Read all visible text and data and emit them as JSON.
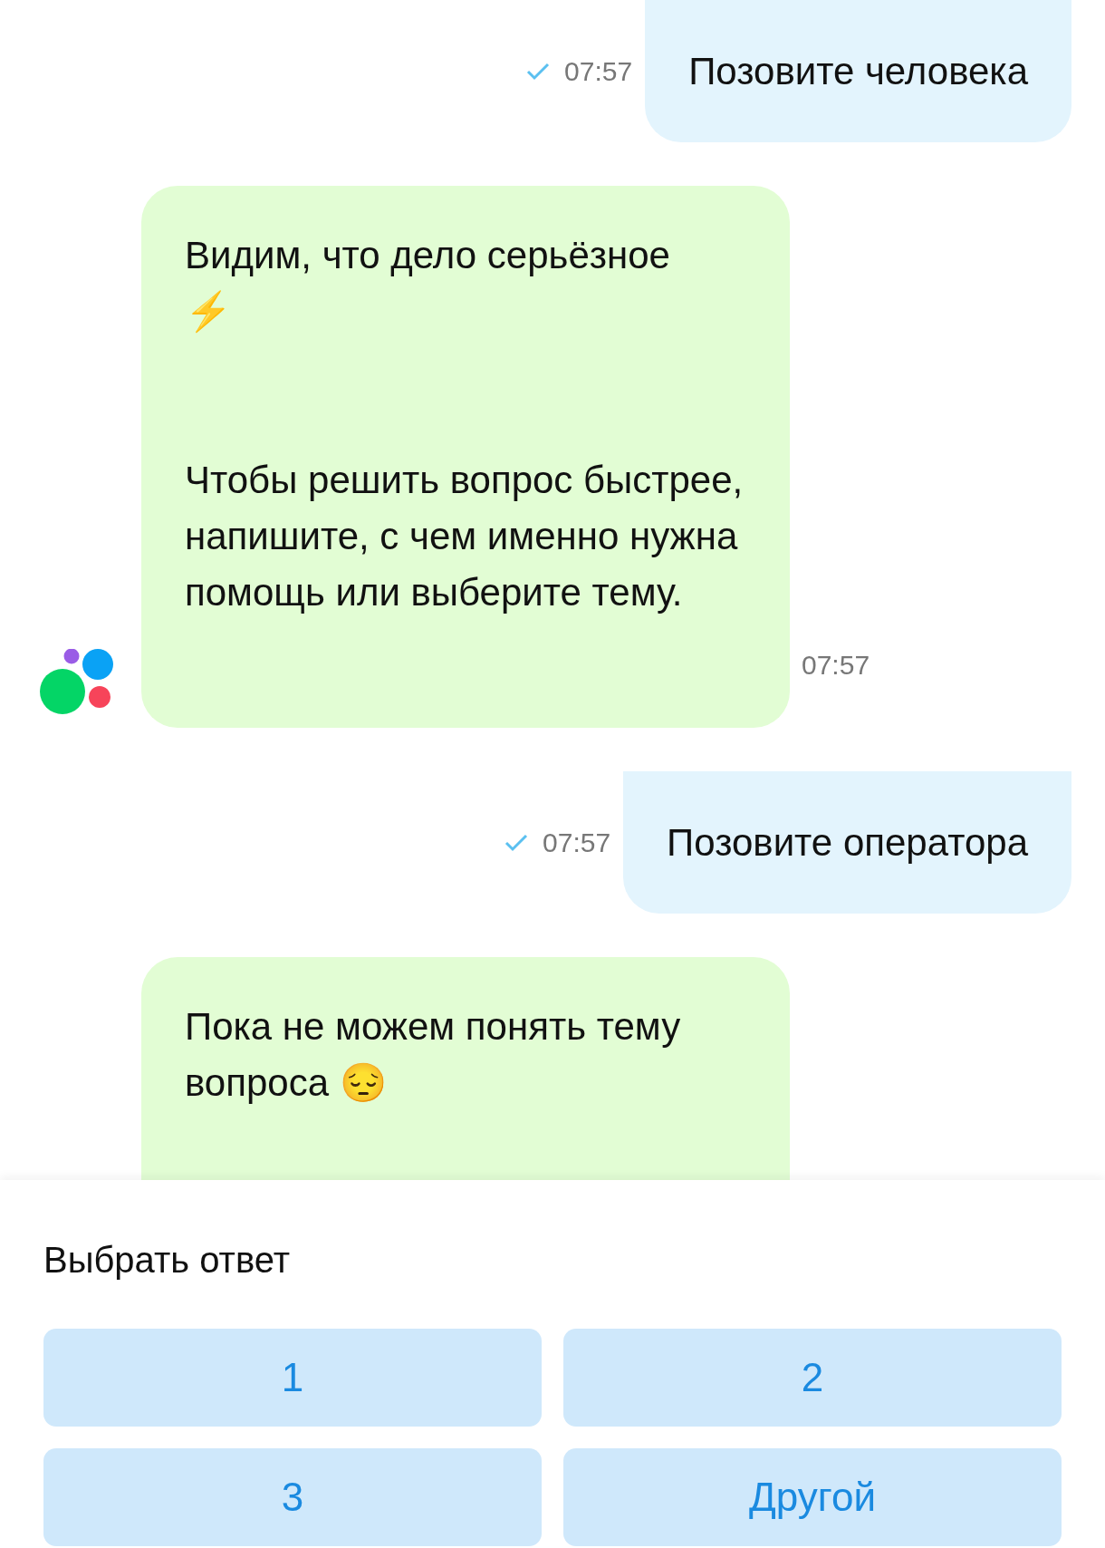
{
  "messages": [
    {
      "kind": "outgoing",
      "text": "Позовите человека",
      "time": "07:57",
      "delivered": true
    },
    {
      "kind": "incoming",
      "text": "Видим, что дело серьёзное\n⚡\n\n\nЧтобы решить вопрос быстрее, напишите, с чем именно нужна помощь или выберите тему.",
      "time": "07:57"
    },
    {
      "kind": "outgoing",
      "text": "Позовите оператора",
      "time": "07:57",
      "delivered": true
    },
    {
      "kind": "incoming",
      "text": "Пока не можем понять тему вопроса 😔"
    }
  ],
  "answer_panel": {
    "title": "Выбрать ответ",
    "options": [
      "1",
      "2",
      "3",
      "Другой"
    ]
  }
}
